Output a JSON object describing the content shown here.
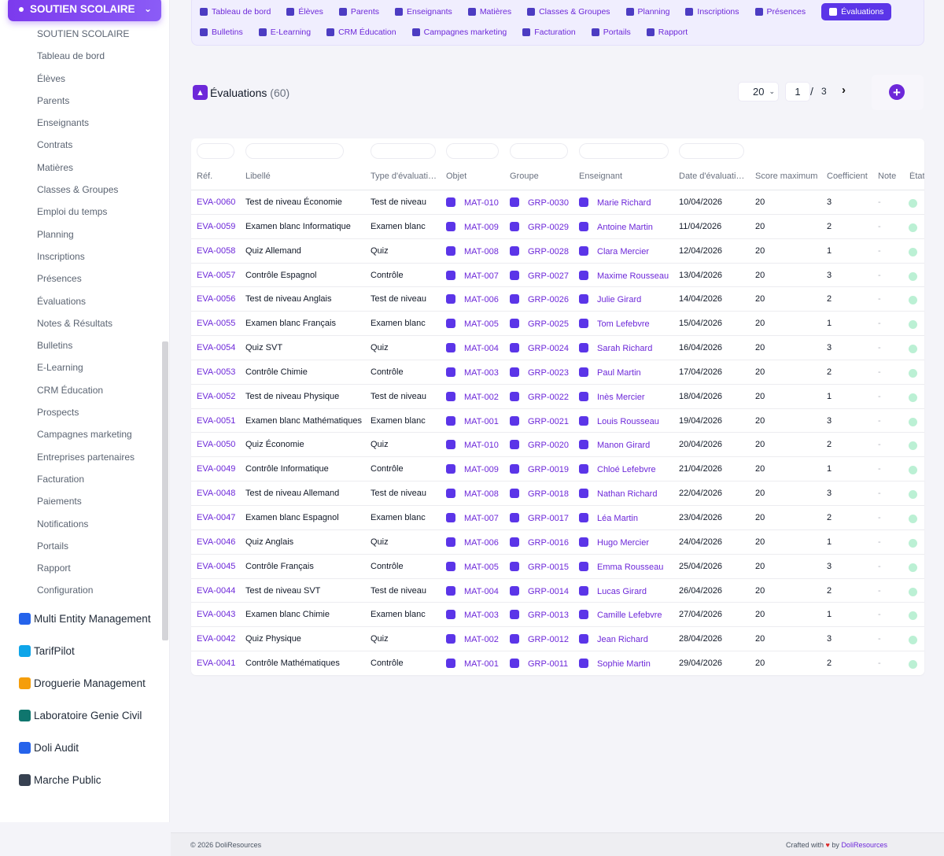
{
  "sidebar": {
    "module_title": "SOUTIEN SCOLAIRE",
    "items": [
      "SOUTIEN SCOLAIRE",
      "Tableau de bord",
      "Élèves",
      "Parents",
      "Enseignants",
      "Contrats",
      "Matières",
      "Classes & Groupes",
      "Emploi du temps",
      "Planning",
      "Inscriptions",
      "Présences",
      "Évaluations",
      "Notes & Résultats",
      "Bulletins",
      "E-Learning",
      "CRM Éducation",
      "Prospects",
      "Campagnes marketing",
      "Entreprises partenaires",
      "Facturation",
      "Paiements",
      "Notifications",
      "Portails",
      "Rapport",
      "Configuration"
    ],
    "modules": [
      {
        "label": "Multi Entity Management",
        "icon": "buildings-icon",
        "color": "#2563eb"
      },
      {
        "label": "TarifPilot",
        "icon": "tarifpilot-icon",
        "color": "#0ea5e9"
      },
      {
        "label": "Droguerie Management",
        "icon": "droguerie-icon",
        "color": "#f59e0b"
      },
      {
        "label": "Laboratoire Genie Civil",
        "icon": "lab-icon",
        "color": "#0f766e"
      },
      {
        "label": "Doli Audit",
        "icon": "audit-icon",
        "color": "#2563eb"
      },
      {
        "label": "Marche Public",
        "icon": "document-icon",
        "color": "#374151"
      }
    ]
  },
  "topnav": {
    "row1": [
      {
        "label": "Tableau de bord",
        "icon": "dashboard-icon"
      },
      {
        "label": "Élèves",
        "icon": "student-icon"
      },
      {
        "label": "Parents",
        "icon": "users-icon"
      },
      {
        "label": "Enseignants",
        "icon": "teacher-icon"
      },
      {
        "label": "Matières",
        "icon": "book-icon"
      },
      {
        "label": "Classes & Groupes",
        "icon": "layers-icon"
      },
      {
        "label": "Planning",
        "icon": "calendar-icon"
      },
      {
        "label": "Inscriptions",
        "icon": "checklist-icon"
      },
      {
        "label": "Présences",
        "icon": "clipboard-icon"
      },
      {
        "label": "Évaluations",
        "icon": "edit-icon",
        "active": true
      }
    ],
    "row2": [
      {
        "label": "Bulletins",
        "icon": "file-icon"
      },
      {
        "label": "E-Learning",
        "icon": "video-icon"
      },
      {
        "label": "CRM Éducation",
        "icon": "list-icon"
      },
      {
        "label": "Campagnes marketing",
        "icon": "megaphone-icon"
      },
      {
        "label": "Facturation",
        "icon": "invoice-icon"
      },
      {
        "label": "Portails",
        "icon": "user-circle-icon"
      },
      {
        "label": "Rapport",
        "icon": "pie-icon"
      }
    ]
  },
  "page": {
    "title": "Évaluations",
    "count": "(60)",
    "per_page": "20",
    "current_page": "1",
    "page_sep": "/",
    "total_pages": "3"
  },
  "table": {
    "headers": [
      "Réf.",
      "Libellé",
      "Type d'évaluati…",
      "Objet",
      "Groupe",
      "Enseignant",
      "Date d'évaluati…",
      "Score maximum",
      "Coefficient",
      "Note",
      "État"
    ],
    "rows": [
      [
        "EVA-0060",
        "Test de niveau Économie",
        "Test de niveau",
        "MAT-010",
        "GRP-0030",
        "Marie Richard",
        "10/04/2026",
        "20",
        "3",
        "-"
      ],
      [
        "EVA-0059",
        "Examen blanc Informatique",
        "Examen blanc",
        "MAT-009",
        "GRP-0029",
        "Antoine Martin",
        "11/04/2026",
        "20",
        "2",
        "-"
      ],
      [
        "EVA-0058",
        "Quiz Allemand",
        "Quiz",
        "MAT-008",
        "GRP-0028",
        "Clara Mercier",
        "12/04/2026",
        "20",
        "1",
        "-"
      ],
      [
        "EVA-0057",
        "Contrôle Espagnol",
        "Contrôle",
        "MAT-007",
        "GRP-0027",
        "Maxime Rousseau",
        "13/04/2026",
        "20",
        "3",
        "-"
      ],
      [
        "EVA-0056",
        "Test de niveau Anglais",
        "Test de niveau",
        "MAT-006",
        "GRP-0026",
        "Julie Girard",
        "14/04/2026",
        "20",
        "2",
        "-"
      ],
      [
        "EVA-0055",
        "Examen blanc Français",
        "Examen blanc",
        "MAT-005",
        "GRP-0025",
        "Tom Lefebvre",
        "15/04/2026",
        "20",
        "1",
        "-"
      ],
      [
        "EVA-0054",
        "Quiz SVT",
        "Quiz",
        "MAT-004",
        "GRP-0024",
        "Sarah Richard",
        "16/04/2026",
        "20",
        "3",
        "-"
      ],
      [
        "EVA-0053",
        "Contrôle Chimie",
        "Contrôle",
        "MAT-003",
        "GRP-0023",
        "Paul Martin",
        "17/04/2026",
        "20",
        "2",
        "-"
      ],
      [
        "EVA-0052",
        "Test de niveau Physique",
        "Test de niveau",
        "MAT-002",
        "GRP-0022",
        "Inès Mercier",
        "18/04/2026",
        "20",
        "1",
        "-"
      ],
      [
        "EVA-0051",
        "Examen blanc Mathématiques",
        "Examen blanc",
        "MAT-001",
        "GRP-0021",
        "Louis Rousseau",
        "19/04/2026",
        "20",
        "3",
        "-"
      ],
      [
        "EVA-0050",
        "Quiz Économie",
        "Quiz",
        "MAT-010",
        "GRP-0020",
        "Manon Girard",
        "20/04/2026",
        "20",
        "2",
        "-"
      ],
      [
        "EVA-0049",
        "Contrôle Informatique",
        "Contrôle",
        "MAT-009",
        "GRP-0019",
        "Chloé Lefebvre",
        "21/04/2026",
        "20",
        "1",
        "-"
      ],
      [
        "EVA-0048",
        "Test de niveau Allemand",
        "Test de niveau",
        "MAT-008",
        "GRP-0018",
        "Nathan Richard",
        "22/04/2026",
        "20",
        "3",
        "-"
      ],
      [
        "EVA-0047",
        "Examen blanc Espagnol",
        "Examen blanc",
        "MAT-007",
        "GRP-0017",
        "Léa Martin",
        "23/04/2026",
        "20",
        "2",
        "-"
      ],
      [
        "EVA-0046",
        "Quiz Anglais",
        "Quiz",
        "MAT-006",
        "GRP-0016",
        "Hugo Mercier",
        "24/04/2026",
        "20",
        "1",
        "-"
      ],
      [
        "EVA-0045",
        "Contrôle Français",
        "Contrôle",
        "MAT-005",
        "GRP-0015",
        "Emma Rousseau",
        "25/04/2026",
        "20",
        "3",
        "-"
      ],
      [
        "EVA-0044",
        "Test de niveau SVT",
        "Test de niveau",
        "MAT-004",
        "GRP-0014",
        "Lucas Girard",
        "26/04/2026",
        "20",
        "2",
        "-"
      ],
      [
        "EVA-0043",
        "Examen blanc Chimie",
        "Examen blanc",
        "MAT-003",
        "GRP-0013",
        "Camille Lefebvre",
        "27/04/2026",
        "20",
        "1",
        "-"
      ],
      [
        "EVA-0042",
        "Quiz Physique",
        "Quiz",
        "MAT-002",
        "GRP-0012",
        "Jean Richard",
        "28/04/2026",
        "20",
        "3",
        "-"
      ],
      [
        "EVA-0041",
        "Contrôle Mathématiques",
        "Contrôle",
        "MAT-001",
        "GRP-0011",
        "Sophie Martin",
        "29/04/2026",
        "20",
        "2",
        "-"
      ]
    ]
  },
  "footer": {
    "copyright": "© 2026 DoliResources",
    "crafted": "Crafted with",
    "heart": "♥",
    "by": "by",
    "brand": "DoliResources"
  },
  "colors": {
    "accent": "#6d28d9",
    "active_tab": "#5b35e8",
    "status_dot": "#bbf0d4"
  }
}
